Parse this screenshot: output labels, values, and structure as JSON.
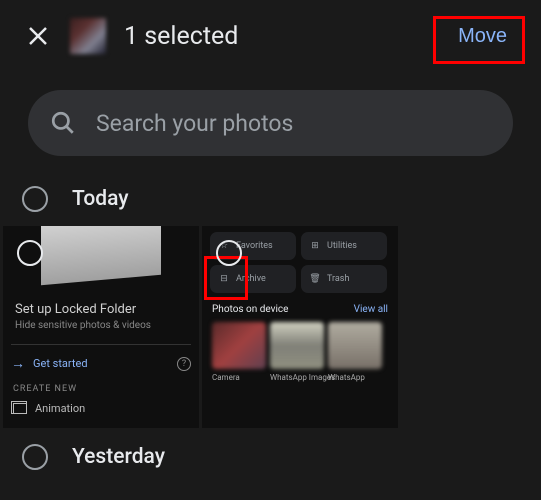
{
  "header": {
    "selection_count": "1 selected",
    "move_label": "Move"
  },
  "search": {
    "placeholder": "Search your photos"
  },
  "sections": {
    "today": "Today",
    "yesterday": "Yesterday"
  },
  "card1": {
    "title": "Set up Locked Folder",
    "subtitle": "Hide sensitive photos & videos",
    "get_started": "Get started",
    "create_new": "CREATE NEW",
    "animation": "Animation"
  },
  "card2": {
    "buttons": {
      "favorites": "Favorites",
      "utilities": "Utilities",
      "archive": "Archive",
      "trash": "Trash"
    },
    "photos_on_device": "Photos on device",
    "view_all": "View all",
    "thumbs": {
      "camera": "Camera",
      "whatsapp_images": "WhatsApp Images",
      "whatsapp": "WhatsApp"
    }
  }
}
